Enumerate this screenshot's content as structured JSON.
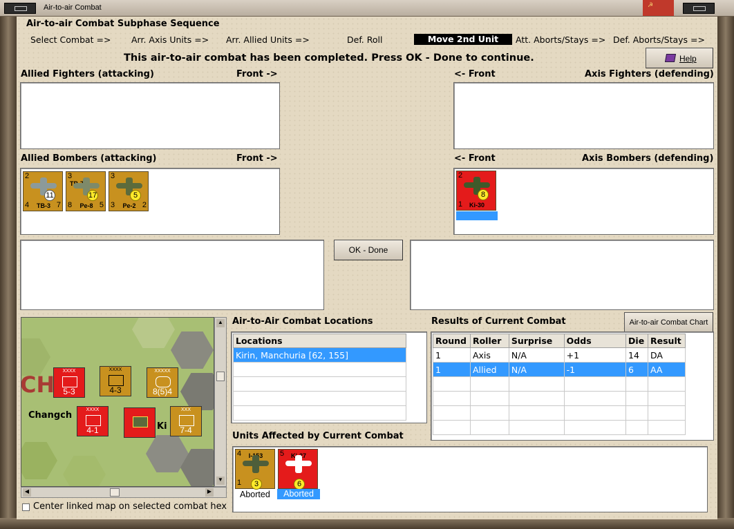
{
  "window": {
    "title": "Air-to-air Combat"
  },
  "sequence": {
    "title": "Air-to-air Combat Subphase Sequence",
    "steps": [
      "Select Combat =>",
      "Arr. Axis Units =>",
      "Arr. Allied Units =>",
      "Def. Roll",
      "Move 2nd Unit",
      "Att. Aborts/Stays =>",
      "Def. Aborts/Stays =>"
    ],
    "active_step": "Move 2nd Unit"
  },
  "message": "This air-to-air combat has been completed.  Press OK - Done to continue.",
  "help_button": "Help",
  "panels": {
    "allied_fighters": {
      "label": "Allied Fighters (attacking)",
      "front": "Front ->"
    },
    "axis_fighters": {
      "label": "Axis Fighters (defending)",
      "front": "<- Front"
    },
    "allied_bombers": {
      "label": "Allied Bombers (attacking)",
      "front": "Front ->"
    },
    "axis_bombers": {
      "label": "Axis Bombers (defending)",
      "front": "<- Front"
    }
  },
  "allied_bomber_units": [
    {
      "name": "TB-3",
      "tl": "2",
      "bl": "4",
      "br": "7",
      "badge": "11",
      "badge_color": "white",
      "tag": ""
    },
    {
      "name": "Pe-8",
      "tl": "3",
      "bl": "8",
      "br": "5",
      "badge": "17",
      "badge_color": "yellow",
      "tag": "TB-7"
    },
    {
      "name": "Pe-2",
      "tl": "3",
      "bl": "3",
      "br": "2",
      "badge": "5",
      "badge_color": "yellow",
      "tag": ""
    }
  ],
  "axis_bomber_units": [
    {
      "name": "Ki-30",
      "tl": "2",
      "bl": "1",
      "br": "",
      "badge": "8",
      "badge_color": "yellow",
      "tag": ""
    }
  ],
  "ok_button": "OK - Done",
  "locations": {
    "title": "Air-to-Air Combat Locations",
    "header": "Locations",
    "rows": [
      "Kirin, Manchuria [62, 155]"
    ]
  },
  "results": {
    "title": "Results of Current Combat",
    "chart_button": "Air-to-air Combat Chart",
    "headers": [
      "Round",
      "Roller",
      "Surprise",
      "Odds",
      "Die",
      "Result"
    ],
    "rows": [
      [
        "1",
        "Axis",
        "N/A",
        "+1",
        "14",
        "DA"
      ],
      [
        "1",
        "Allied",
        "N/A",
        "-1",
        "6",
        "AA"
      ]
    ],
    "selected_row": 1
  },
  "affected": {
    "title": "Units Affected by Current Combat",
    "units": [
      {
        "name": "I-153",
        "tl": "4",
        "bl": "1",
        "badge": "3",
        "status": "Aborted",
        "color": "tan"
      },
      {
        "name": "Ki-27",
        "tl": "5",
        "bl": "",
        "badge": "6",
        "status": "Aborted",
        "color": "red"
      }
    ]
  },
  "map": {
    "place_label_1": "Changch",
    "place_label_2": "CHU",
    "place_label_3": "Ki",
    "units": [
      {
        "size": "XXXX",
        "value": "5-3",
        "color": "red"
      },
      {
        "size": "XXXX",
        "value": "4-3",
        "color": "tan",
        "stack": "2"
      },
      {
        "size": "XXXXX",
        "value": "8(5)4",
        "color": "tan",
        "stack": "3"
      },
      {
        "size": "XXXX",
        "value": "4-1",
        "color": "red",
        "stack": "2"
      },
      {
        "size": "XXX",
        "value": "7-4",
        "color": "tan",
        "stack": "2"
      }
    ]
  },
  "center_map_checkbox": "Center linked map on selected combat hex",
  "colors": {
    "active_step_bg": "#000000",
    "selection": "#3399ff",
    "axis_counter": "#e41b1b",
    "allied_counter": "#c8911f"
  }
}
